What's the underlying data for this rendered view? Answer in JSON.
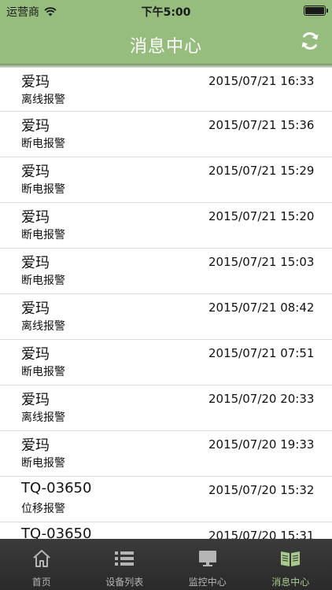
{
  "status_bar": {
    "carrier": "运营商",
    "time": "下午5:00"
  },
  "nav": {
    "title": "消息中心",
    "refresh_icon": "refresh-icon"
  },
  "messages": [
    {
      "name": "爱玛",
      "type": "离线报警",
      "time": "2015/07/21 16:33"
    },
    {
      "name": "爱玛",
      "type": "断电报警",
      "time": "2015/07/21 15:36"
    },
    {
      "name": "爱玛",
      "type": "断电报警",
      "time": "2015/07/21 15:29"
    },
    {
      "name": "爱玛",
      "type": "断电报警",
      "time": "2015/07/21 15:20"
    },
    {
      "name": "爱玛",
      "type": "断电报警",
      "time": "2015/07/21 15:03"
    },
    {
      "name": "爱玛",
      "type": "离线报警",
      "time": "2015/07/21 08:42"
    },
    {
      "name": "爱玛",
      "type": "断电报警",
      "time": "2015/07/21 07:51"
    },
    {
      "name": "爱玛",
      "type": "离线报警",
      "time": "2015/07/20 20:33"
    },
    {
      "name": "爱玛",
      "type": "断电报警",
      "time": "2015/07/20 19:33"
    },
    {
      "name": "TQ-03650",
      "type": "位移报警",
      "time": "2015/07/20 15:32"
    },
    {
      "name": "TQ-03650",
      "type": "",
      "time": "2015/07/20 15:31"
    }
  ],
  "tabs": [
    {
      "label": "首页",
      "icon": "home-icon",
      "active": false
    },
    {
      "label": "设备列表",
      "icon": "list-icon",
      "active": false
    },
    {
      "label": "监控中心",
      "icon": "monitor-icon",
      "active": false
    },
    {
      "label": "消息中心",
      "icon": "book-icon",
      "active": true
    }
  ],
  "colors": {
    "accent": "#96bd7e",
    "tab_bar": "#2f2f2f",
    "tab_active": "#a8c98d"
  }
}
